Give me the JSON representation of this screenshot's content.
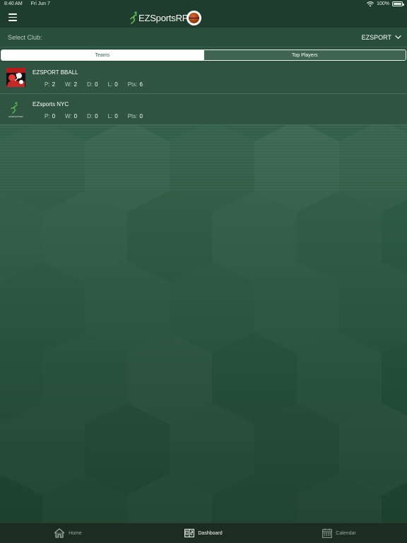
{
  "status_bar": {
    "time": "8:40 AM",
    "date": "Fri Jun 7",
    "battery": "100%"
  },
  "header": {
    "app_name": "EZSportsRP"
  },
  "club_selector": {
    "label": "Select Club:",
    "value": "EZSPORT"
  },
  "tabs": [
    {
      "label": "Teams",
      "active": true
    },
    {
      "label": "Top Players",
      "active": false
    }
  ],
  "teams": [
    {
      "name": "EZSPORT BBALL",
      "stats": [
        {
          "key": "P:",
          "value": "2"
        },
        {
          "key": "W:",
          "value": "2"
        },
        {
          "key": "D:",
          "value": "0"
        },
        {
          "key": "L:",
          "value": "0"
        },
        {
          "key": "Pts:",
          "value": "6"
        }
      ]
    },
    {
      "name": "EZsports NYC",
      "logo_text": "EZSPORTSRP",
      "stats": [
        {
          "key": "P:",
          "value": "0"
        },
        {
          "key": "W:",
          "value": "0"
        },
        {
          "key": "D:",
          "value": "0"
        },
        {
          "key": "L:",
          "value": "0"
        },
        {
          "key": "Pts:",
          "value": "0"
        }
      ]
    }
  ],
  "bottom_nav": [
    {
      "label": "Home",
      "icon": "home-icon",
      "active": false
    },
    {
      "label": "Dashboard",
      "icon": "scoreboard-icon",
      "active": true
    },
    {
      "label": "Calendar",
      "icon": "calendar-icon",
      "active": false
    }
  ],
  "colors": {
    "background_dark": "#1b402d",
    "header": "#1f3d2f",
    "tab_bar": "#1c2c23",
    "accent_green": "#4caf50"
  }
}
